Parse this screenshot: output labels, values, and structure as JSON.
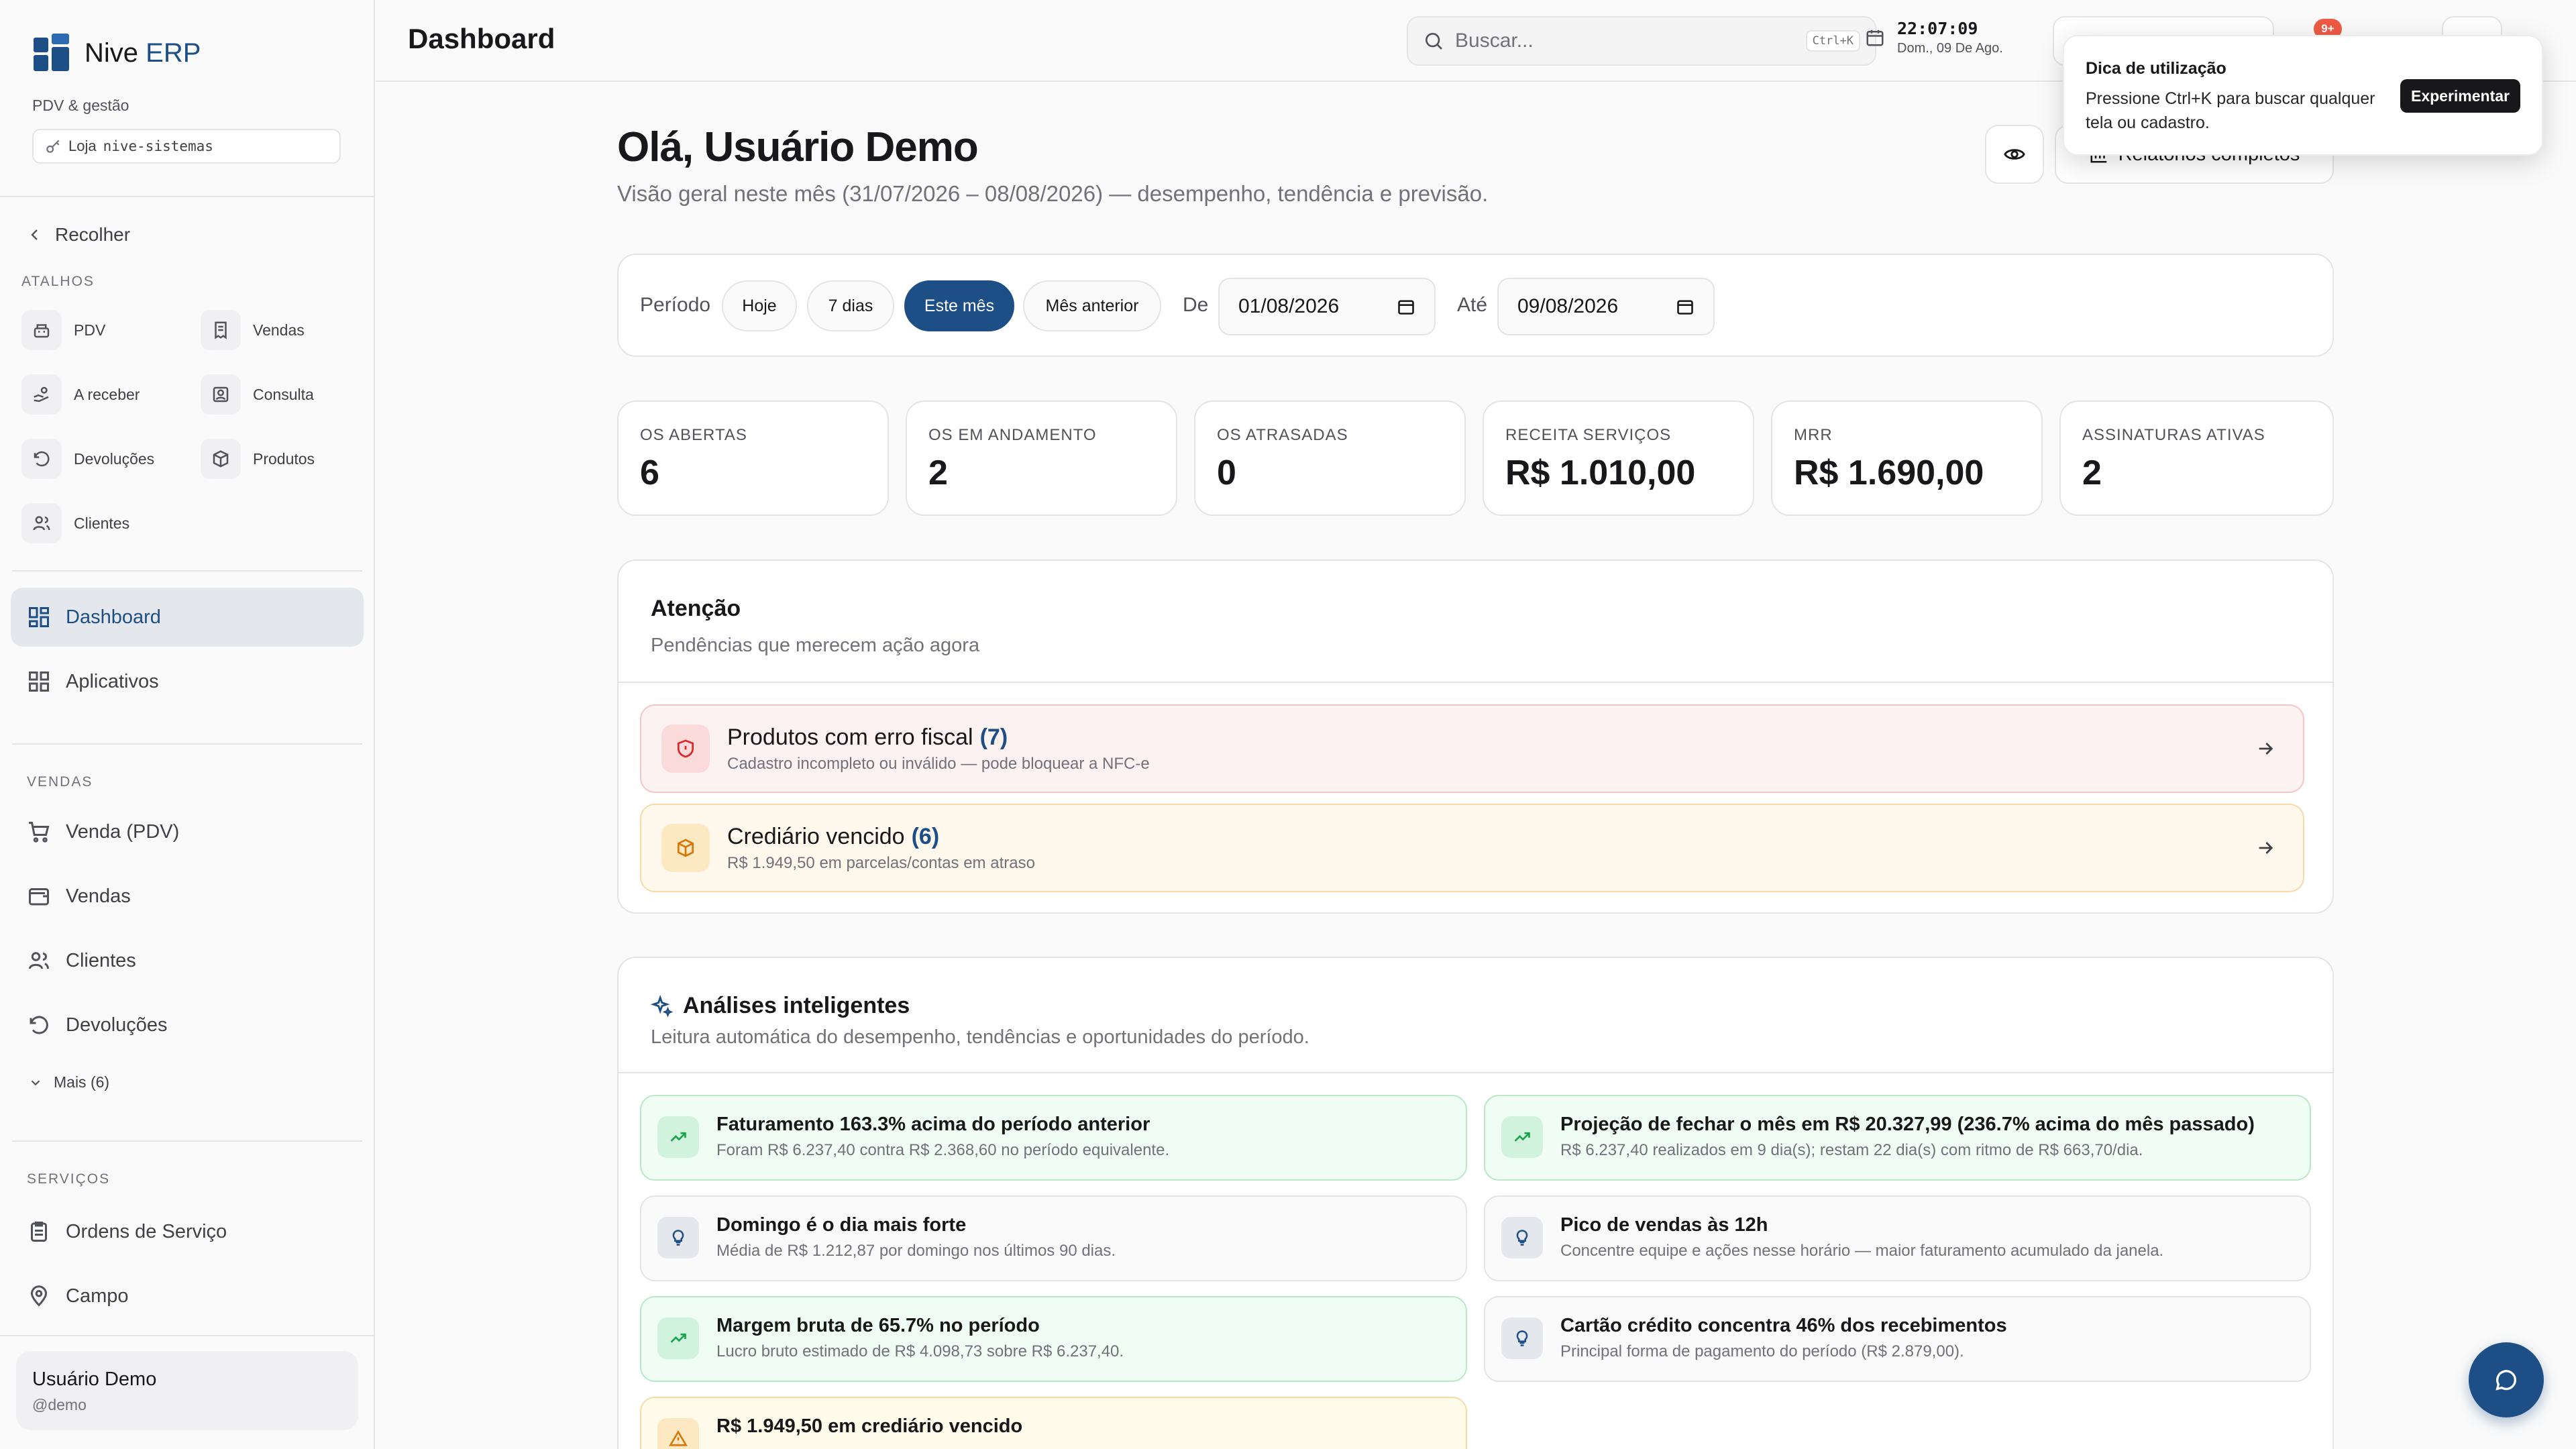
{
  "brand": {
    "name_main": "Nive",
    "name_accent": "ERP",
    "subtitle": "PDV & gestão",
    "store_label": "Loja",
    "store_code": "nive-sistemas"
  },
  "sidebar": {
    "collapse_label": "Recolher",
    "shortcuts_label": "ATALHOS",
    "shortcuts": [
      {
        "label": "PDV",
        "icon": "cash-register-icon"
      },
      {
        "label": "Vendas",
        "icon": "receipt-icon"
      },
      {
        "label": "A receber",
        "icon": "hand-coins-icon"
      },
      {
        "label": "Consulta",
        "icon": "scan-icon"
      },
      {
        "label": "Devoluções",
        "icon": "undo-icon"
      },
      {
        "label": "Produtos",
        "icon": "package-icon"
      },
      {
        "label": "Clientes",
        "icon": "users-icon"
      }
    ],
    "main_nav": [
      {
        "label": "Dashboard",
        "icon": "grid-icon",
        "active": true
      },
      {
        "label": "Aplicativos",
        "icon": "apps-icon",
        "active": false
      }
    ],
    "vendas_label": "VENDAS",
    "vendas_nav": [
      {
        "label": "Venda (PDV)",
        "icon": "cart-icon"
      },
      {
        "label": "Vendas",
        "icon": "wallet-icon"
      },
      {
        "label": "Clientes",
        "icon": "users-icon"
      },
      {
        "label": "Devoluções",
        "icon": "undo-icon"
      }
    ],
    "more_label": "Mais (6)",
    "servicos_label": "SERVIÇOS",
    "servicos_nav": [
      {
        "label": "Ordens de Serviço",
        "icon": "clipboard-icon"
      },
      {
        "label": "Campo",
        "icon": "map-pin-icon"
      }
    ],
    "user": {
      "name": "Usuário Demo",
      "handle": "@demo"
    }
  },
  "header": {
    "title": "Dashboard",
    "search_placeholder": "Buscar...",
    "search_shortcut": "Ctrl+K",
    "time": "22:07:09",
    "date": "Dom., 09 De Ago.",
    "notification_count": "9+"
  },
  "tip": {
    "title": "Dica de utilização",
    "body": "Pressione Ctrl+K para buscar qualquer tela ou cadastro.",
    "button": "Experimentar"
  },
  "main": {
    "greeting": "Olá, Usuário Demo",
    "subtitle": "Visão geral neste mês (31/07/2026 – 08/08/2026) — desempenho, tendência e previsão.",
    "reports_button": "Relatórios completos",
    "period": {
      "label": "Período",
      "chips": [
        {
          "label": "Hoje",
          "active": false
        },
        {
          "label": "7 dias",
          "active": false
        },
        {
          "label": "Este mês",
          "active": true
        },
        {
          "label": "Mês anterior",
          "active": false
        }
      ],
      "from_label": "De",
      "from_value": "01/08/2026",
      "to_label": "Até",
      "to_value": "09/08/2026"
    },
    "kpis": [
      {
        "label": "OS ABERTAS",
        "value": "6"
      },
      {
        "label": "OS EM ANDAMENTO",
        "value": "2"
      },
      {
        "label": "OS ATRASADAS",
        "value": "0"
      },
      {
        "label": "RECEITA SERVIÇOS",
        "value": "R$ 1.010,00"
      },
      {
        "label": "MRR",
        "value": "R$ 1.690,00"
      },
      {
        "label": "ASSINATURAS ATIVAS",
        "value": "2"
      }
    ],
    "attention": {
      "title": "Atenção",
      "subtitle": "Pendências que merecem ação agora",
      "items": [
        {
          "title": "Produtos com erro fiscal",
          "count": "(7)",
          "desc": "Cadastro incompleto ou inválido — pode bloquear a NFC-e",
          "tone": "red",
          "icon": "shield-icon"
        },
        {
          "title": "Crediário vencido",
          "count": "(6)",
          "desc": "R$ 1.949,50 em parcelas/contas em atraso",
          "tone": "amber",
          "icon": "package-icon"
        }
      ]
    },
    "insights": {
      "title": "Análises inteligentes",
      "subtitle": "Leitura automática do desempenho, tendências e oportunidades do período.",
      "items": [
        {
          "title": "Faturamento 163.3% acima do período anterior",
          "desc": "Foram R$ 6.237,40 contra R$ 2.368,60 no período equivalente.",
          "tone": "green",
          "icon": "trending-up-icon"
        },
        {
          "title": "Projeção de fechar o mês em R$ 20.327,99 (236.7% acima do mês passado)",
          "desc": "R$ 6.237,40 realizados em 9 dia(s); restam 22 dia(s) com ritmo de R$ 663,70/dia.",
          "tone": "green",
          "icon": "trending-up-icon"
        },
        {
          "title": "Domingo é o dia mais forte",
          "desc": "Média de R$ 1.212,87 por domingo nos últimos 90 dias.",
          "tone": "neutral",
          "icon": "lightbulb-icon"
        },
        {
          "title": "Pico de vendas às 12h",
          "desc": "Concentre equipe e ações nesse horário — maior faturamento acumulado da janela.",
          "tone": "neutral",
          "icon": "lightbulb-icon"
        },
        {
          "title": "Margem bruta de 65.7% no período",
          "desc": "Lucro bruto estimado de R$ 4.098,73 sobre R$ 6.237,40.",
          "tone": "green",
          "icon": "trending-up-icon"
        },
        {
          "title": "Cartão crédito concentra 46% dos recebimentos",
          "desc": "Principal forma de pagamento do período (R$ 2.879,00).",
          "tone": "neutral",
          "icon": "lightbulb-icon"
        },
        {
          "title": "R$ 1.949,50 em crediário vencido",
          "desc": "",
          "tone": "amber",
          "icon": "warning-icon"
        }
      ]
    }
  },
  "colors": {
    "brand": "#1e4e86",
    "green": "#16a34a",
    "amber": "#d97706",
    "red": "#dc2626"
  }
}
